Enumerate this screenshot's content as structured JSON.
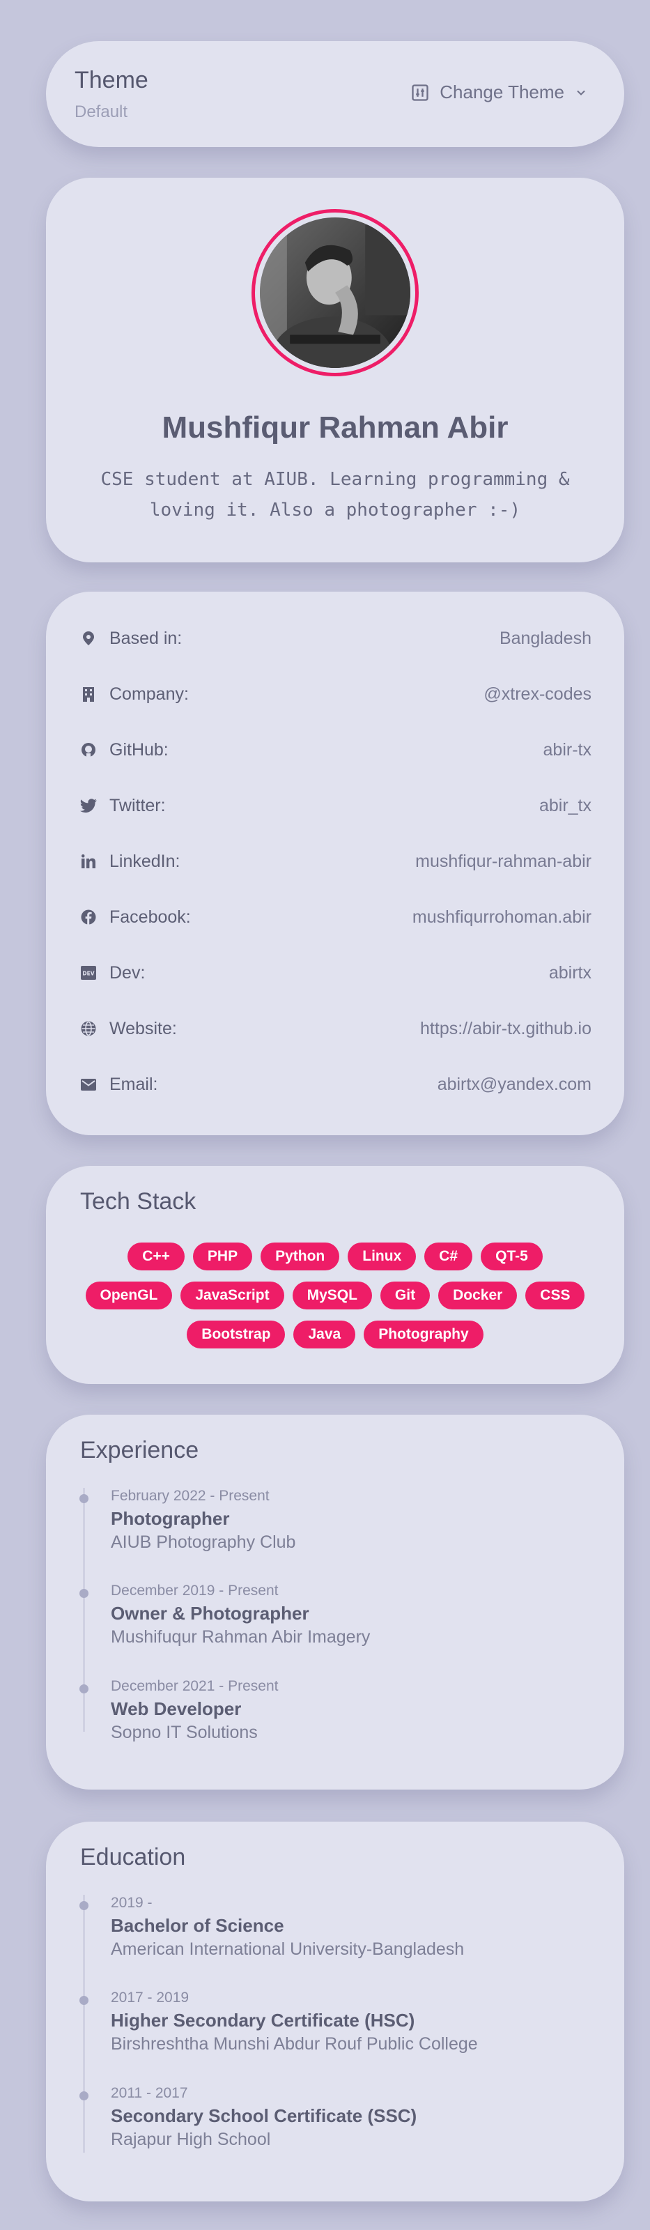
{
  "theme": {
    "title": "Theme",
    "current": "Default",
    "button_label": "Change Theme",
    "icons": {
      "button": "sliders-icon",
      "chevron": "chevron-down-icon"
    }
  },
  "profile": {
    "name": "Mushfiqur Rahman Abir",
    "bio": "CSE student at AIUB. Learning programming & loving it. Also a photographer :-)",
    "accent_color": "#ee1d67"
  },
  "info": [
    {
      "icon": "map-pin-icon",
      "label": "Based in:",
      "value": "Bangladesh"
    },
    {
      "icon": "building-icon",
      "label": "Company:",
      "value": "@xtrex-codes"
    },
    {
      "icon": "github-icon",
      "label": "GitHub:",
      "value": "abir-tx"
    },
    {
      "icon": "twitter-icon",
      "label": "Twitter:",
      "value": "abir_tx"
    },
    {
      "icon": "linkedin-icon",
      "label": "LinkedIn:",
      "value": "mushfiqur-rahman-abir"
    },
    {
      "icon": "facebook-icon",
      "label": "Facebook:",
      "value": "mushfiqurrohoman.abir"
    },
    {
      "icon": "dev-icon",
      "label": "Dev:",
      "value": "abirtx"
    },
    {
      "icon": "globe-icon",
      "label": "Website:",
      "value": "https://abir-tx.github.io"
    },
    {
      "icon": "mail-icon",
      "label": "Email:",
      "value": "abirtx@yandex.com"
    }
  ],
  "tech_stack": {
    "title": "Tech Stack",
    "tags": [
      "C++",
      "PHP",
      "Python",
      "Linux",
      "C#",
      "QT-5",
      "OpenGL",
      "JavaScript",
      "MySQL",
      "Git",
      "Docker",
      "CSS",
      "Bootstrap",
      "Java",
      "Photography"
    ]
  },
  "experience": {
    "title": "Experience",
    "items": [
      {
        "date": "February 2022 - Present",
        "role": "Photographer",
        "org": "AIUB Photography Club"
      },
      {
        "date": "December 2019 - Present",
        "role": "Owner & Photographer",
        "org": "Mushifuqur Rahman Abir Imagery"
      },
      {
        "date": "December 2021 - Present",
        "role": "Web Developer",
        "org": "Sopno IT Solutions"
      }
    ]
  },
  "education": {
    "title": "Education",
    "items": [
      {
        "date": "2019 -",
        "role": "Bachelor of Science",
        "org": "American International University-Bangladesh"
      },
      {
        "date": "2017 - 2019",
        "role": "Higher Secondary Certificate (HSC)",
        "org": "Birshreshtha Munshi Abdur Rouf Public College"
      },
      {
        "date": "2011 - 2017",
        "role": "Secondary School Certificate (SSC)",
        "org": "Rajapur High School"
      }
    ]
  }
}
